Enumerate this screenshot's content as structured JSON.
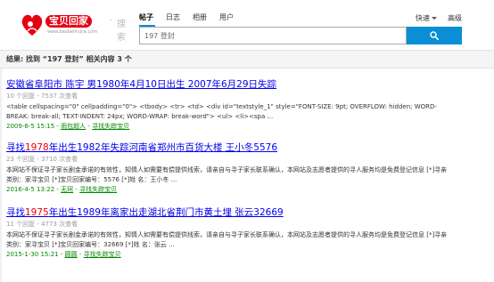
{
  "logo": {
    "text": "宝贝回家",
    "url": "www.baobeihuijia.com",
    "separator": "·",
    "search_word": "搜索"
  },
  "tabs": [
    {
      "label": "帖子",
      "active": true
    },
    {
      "label": "日志",
      "active": false
    },
    {
      "label": "相册",
      "active": false
    },
    {
      "label": "用户",
      "active": false
    }
  ],
  "quick_label": "快速",
  "advanced_label": "高级",
  "search": {
    "value": "197 登封"
  },
  "summary": {
    "prefix": "结果: 找到",
    "query": "“197 登封”",
    "suffix": "相关内容 3 个"
  },
  "results": [
    {
      "title": "安徽省阜阳市 陈宇 男1980年4月10日出生 2007年6月29日失踪",
      "meta": "10 个回复 - 7537 次查看",
      "snippet": "<table cellspacing=\"0\" cellpadding=\"0\"> <tbody> <tr> <td> <div id=\"textstyle_1\" style=\"FONT-SIZE: 9pt; OVERFLOW: hidden; WORD-BREAK: break-all; TEXT-INDENT: 24px; WORD-WRAP: break-word\"> <ul> <li><spa ...",
      "date": "2009-6-5 15:15",
      "author": "雨包超人",
      "forum": "寻找失踪宝贝"
    },
    {
      "title_pre": "寻找",
      "title_hl": "1978",
      "title_post": "年出生1982年失踪河南省郑州市百货大楼 王小冬5576",
      "meta": "23 个回复 - 3710 次查看",
      "snippet": "本网站不保证寻子家长剧金承诺的有效性，知情人如需要有偿提供线索，请亲自与寻子家长联系确认，本网站及志愿者提供的寻人服务均是免费登记信息 [*]寻亲类别：家寻宝贝 [*]宝贝回家编号：5576 [*]姓 名：王小冬 ...",
      "date": "2016-4-5 13:22",
      "author": "无珂",
      "forum": "寻找失踪宝贝"
    },
    {
      "title_pre": "寻找",
      "title_hl": "1975",
      "title_post": "年出生1989年离家出走湖北省荆门市黄土埋 张云32669",
      "meta": "11 个回复 - 4773 次查看",
      "snippet": "本网站不保证寻子家长剧金承诺的有效性，知情人如需要有偿提供线索，请亲自与寻子家长联系确认，本网站及志愿者提供的寻人服务均是免费登记信息 [*]寻亲类别：家寻宝贝 [*]宝贝回家编号：32669 [*]姓 名：张云 ...",
      "date": "2015-1-30 15:21",
      "author": "圆圆",
      "forum": "寻找失踪宝贝"
    }
  ],
  "colors": {
    "accent": "#0a8fd6",
    "link": "#0000ee",
    "highlight": "#e60012",
    "footer": "#008000"
  }
}
